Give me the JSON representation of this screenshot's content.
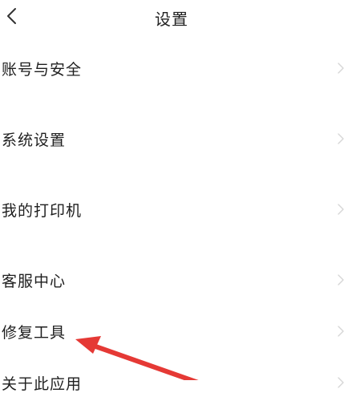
{
  "header": {
    "title": "设置",
    "back_icon": "chevron-left-icon"
  },
  "menu": {
    "items": [
      {
        "label": "账号与安全",
        "icon": "chevron-right-icon"
      },
      {
        "label": "系统设置",
        "icon": "chevron-right-icon"
      },
      {
        "label": "我的打印机",
        "icon": "chevron-right-icon"
      },
      {
        "label": "客服中心",
        "icon": "chevron-right-icon"
      },
      {
        "label": "修复工具",
        "icon": "chevron-right-icon"
      },
      {
        "label": "关于此应用",
        "icon": "chevron-right-icon"
      }
    ]
  },
  "annotation": {
    "arrow_color": "#e53935",
    "points_to": "修复工具"
  },
  "colors": {
    "background": "#ffffff",
    "text": "#1f1f1f",
    "chevron": "#d6d6d6"
  }
}
